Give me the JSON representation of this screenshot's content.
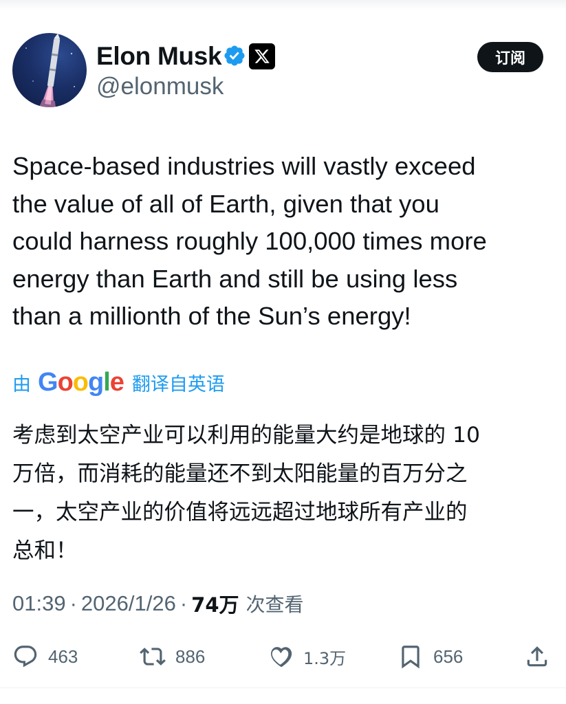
{
  "author": {
    "display_name": "Elon Musk",
    "handle": "@elonmusk",
    "verified": true
  },
  "subscribe_button": {
    "label": "订阅"
  },
  "tweet": {
    "text_lines": [
      "Space-based industries will vastly exceed",
      "the value of all of Earth, given that you",
      "could harness roughly 100,000 times more",
      "energy than Earth and still be using less",
      "than a millionth of the Sun’s energy!"
    ]
  },
  "translation": {
    "prefix": "由",
    "provider": "Google",
    "suffix": "翻译自英语",
    "text_lines": [
      "考虑到太空产业可以利用的能量大约是地球的 10",
      "万倍，而消耗的能量还不到太阳能量的百万分之",
      "一，太空产业的价值将远远超过地球所有产业的",
      "总和！"
    ]
  },
  "meta": {
    "time": "01:39",
    "separator": "·",
    "date": "2026/1/26",
    "views_count": "74万",
    "views_label": "次查看"
  },
  "actions": {
    "replies": "463",
    "reposts": "886",
    "likes": "1.3万",
    "bookmarks": "656"
  },
  "colors": {
    "accent_blue": "#1d9bf0",
    "text_primary": "#0f1419",
    "text_secondary": "#536471",
    "google_blue": "#4285f4",
    "google_red": "#ea4335",
    "google_yellow": "#fbbc05",
    "google_green": "#34a853"
  },
  "icons": {
    "verified": "verified-badge-icon",
    "platform": "x-logo-icon",
    "reply": "reply-bubble-icon",
    "repost": "repost-arrows-icon",
    "like": "heart-icon",
    "bookmark": "bookmark-icon",
    "share": "share-upload-icon"
  }
}
